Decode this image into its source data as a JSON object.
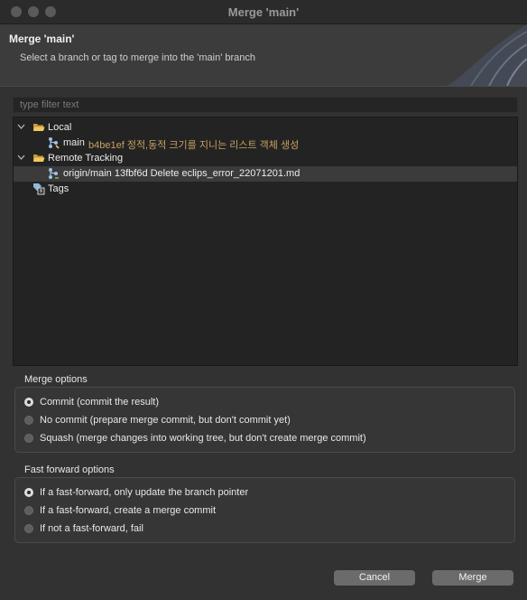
{
  "window": {
    "title": "Merge 'main'"
  },
  "header": {
    "title": "Merge 'main'",
    "description": "Select a branch or tag to merge into the 'main' branch"
  },
  "filter": {
    "placeholder": "type filter text"
  },
  "tree": {
    "local": {
      "label": "Local",
      "branch": {
        "name": "main",
        "commit": "b4be1ef 정적,동적 크기를 지니는 리스트 객체 생성"
      }
    },
    "remote": {
      "label": "Remote Tracking",
      "branch": {
        "name": "origin/main 13fbf6d Delete eclips_error_22071201.md"
      }
    },
    "tags": {
      "label": "Tags"
    }
  },
  "merge_options": {
    "label": "Merge options",
    "options": [
      {
        "label": "Commit (commit the result)",
        "selected": true
      },
      {
        "label": "No commit (prepare merge commit, but don't commit yet)",
        "selected": false
      },
      {
        "label": "Squash (merge changes into working tree, but don't create merge commit)",
        "selected": false
      }
    ]
  },
  "ff_options": {
    "label": "Fast forward options",
    "options": [
      {
        "label": "If a fast-forward, only update the branch pointer",
        "selected": true
      },
      {
        "label": "If a fast-forward, create a merge commit",
        "selected": false
      },
      {
        "label": "If not a fast-forward, fail",
        "selected": false
      }
    ]
  },
  "buttons": {
    "cancel": "Cancel",
    "merge": "Merge"
  }
}
